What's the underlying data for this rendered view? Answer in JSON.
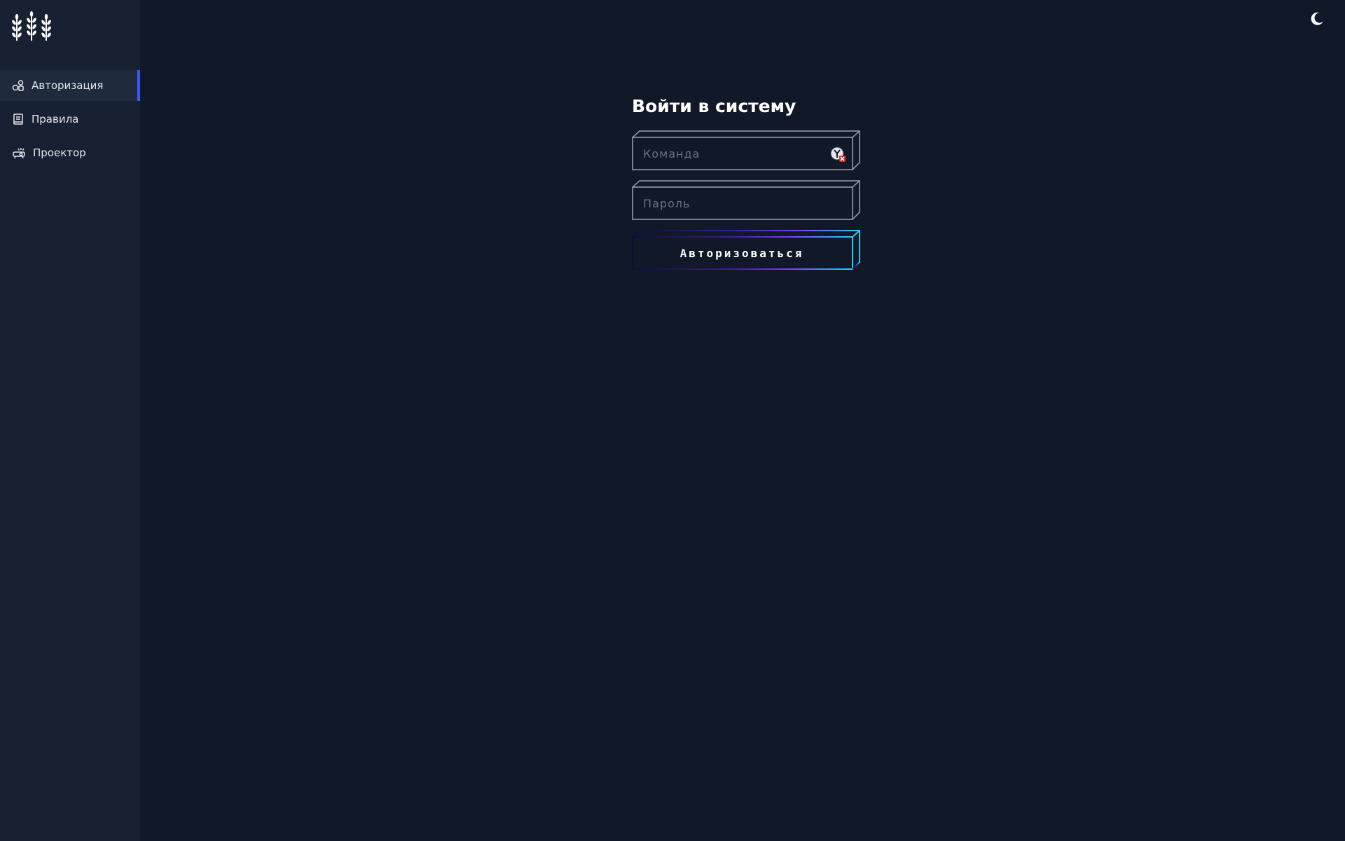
{
  "sidebar": {
    "logo_icon": "wheat-logo-icon",
    "items": [
      {
        "label": "Авторизация",
        "icon": "login-shapes-icon",
        "active": true
      },
      {
        "label": "Правила",
        "icon": "book-icon",
        "active": false
      },
      {
        "label": "Проектор",
        "icon": "projector-icon",
        "active": false
      }
    ]
  },
  "header": {
    "theme_toggle_icon": "moon-icon"
  },
  "login": {
    "title": "Войти в систему",
    "team_placeholder": "Команда",
    "password_placeholder": "Пароль",
    "submit_label": "Авторизоваться",
    "password_manager_icon": "password-manager-icon"
  },
  "colors": {
    "background": "#111827",
    "sidebar": "#172132",
    "active_item": "#1f2a3d",
    "active_indicator": "#3b5bfd",
    "field_border": "#9ca3af",
    "button_gradient_start": "#0b0f3a",
    "button_gradient_mid": "#7c3aed",
    "button_gradient_end": "#22d3ee"
  }
}
